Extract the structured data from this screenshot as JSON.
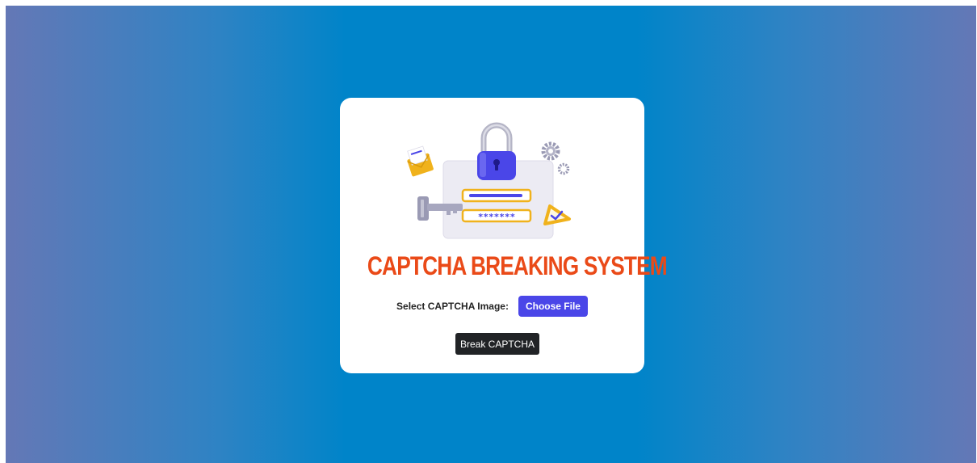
{
  "page": {
    "title": "CAPTCHA BREAKING SYSTEM"
  },
  "form": {
    "file_label": "Select CAPTCHA Image:",
    "choose_file_label": "Choose File",
    "submit_label": "Break CAPTCHA"
  },
  "illustration": {
    "password_mask": "*******",
    "icons": [
      "padlock-icon",
      "envelope-icon",
      "key-icon",
      "gear-icon",
      "warning-check-icon"
    ]
  },
  "colors": {
    "title": "#ea4a18",
    "choose_button": "#4a46e8",
    "submit_button": "#212326",
    "background_center": "#0084c9",
    "background_edge": "#6478b6"
  }
}
